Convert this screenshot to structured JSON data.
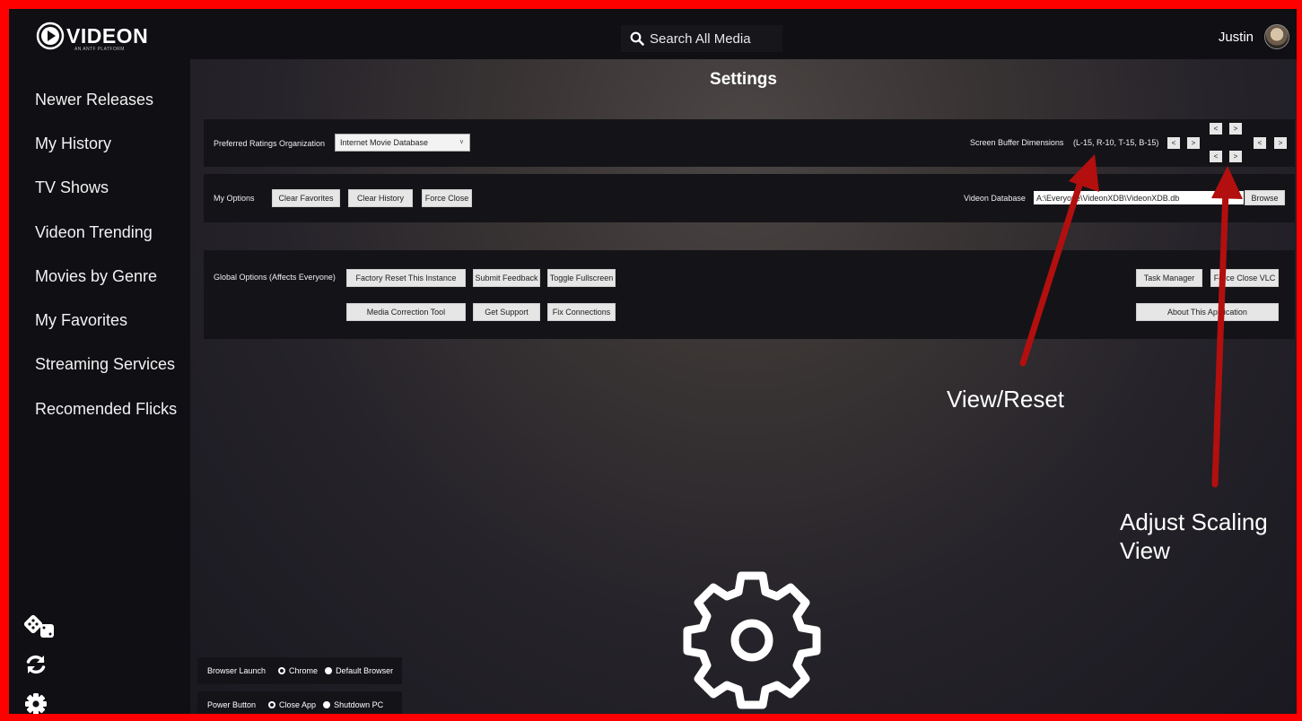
{
  "app": {
    "logo_text": "VIDEON",
    "logo_sub": "AN ANTF PLATFORM",
    "search_placeholder": "Search All Media",
    "user_name": "Justin"
  },
  "sidebar": {
    "items": [
      {
        "label": "Newer Releases"
      },
      {
        "label": "My History"
      },
      {
        "label": "TV Shows"
      },
      {
        "label": "Videon Trending"
      },
      {
        "label": "Movies by Genre"
      },
      {
        "label": "My Favorites"
      },
      {
        "label": "Streaming Services"
      },
      {
        "label": "Recomended Flicks"
      }
    ],
    "bottom_icons": [
      "dice-icon",
      "refresh-icon",
      "gear-icon"
    ]
  },
  "settings": {
    "title": "Settings",
    "ratings": {
      "label": "Preferred Ratings Organization",
      "selected": "Internet Movie Database"
    },
    "screen_buffer": {
      "label": "Screen Buffer Dimensions",
      "value": "(L-15, R-10, T-15, B-15)",
      "prev": "<",
      "next": ">"
    },
    "my_options": {
      "label": "My Options",
      "buttons": [
        "Clear Favorites",
        "Clear History",
        "Force Close"
      ]
    },
    "database": {
      "label": "Videon Database",
      "path": "A:\\Everyone\\VideonXDB\\VideonXDB.db",
      "browse": "Browse"
    },
    "global_options": {
      "label": "Global Options (Affects Everyone)",
      "row1": [
        "Factory Reset This Instance",
        "Submit Feedback",
        "Toggle Fullscreen"
      ],
      "row2": [
        "Media Correction Tool",
        "Get Support",
        "Fix Connections"
      ],
      "right1": [
        "Task Manager",
        "Force Close VLC"
      ],
      "right2": "About This Application"
    },
    "browser_launch": {
      "label": "Browser Launch",
      "options": [
        "Chrome",
        "Default Browser"
      ],
      "selected": "Chrome"
    },
    "power_button": {
      "label": "Power Button",
      "options": [
        "Close App",
        "Shutdown PC"
      ],
      "selected": "Close App"
    }
  },
  "annotations": {
    "view_reset": "View/Reset",
    "adjust_line1": "Adjust Scaling",
    "adjust_line2": "View"
  },
  "colors": {
    "frame": "#ff0000",
    "arrow": "#b30f0f",
    "panel": "#141418",
    "sidebar": "#0f0f14"
  }
}
